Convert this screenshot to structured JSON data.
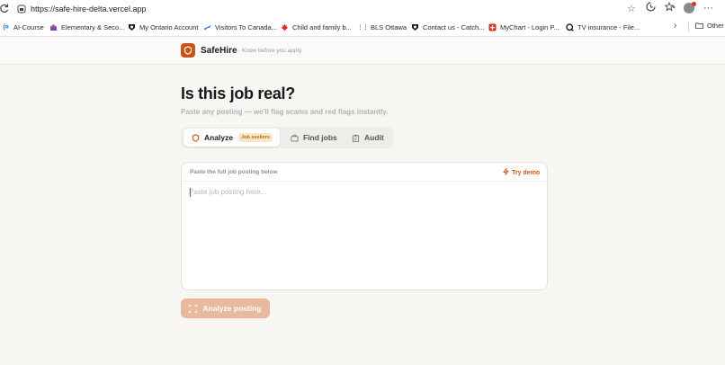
{
  "browser": {
    "url": "https://safe-hire-delta.vercel.app",
    "bookmarks": [
      {
        "label": "AI-Course",
        "icon": "course-icon",
        "color": "#1a73e8"
      },
      {
        "label": "Elementary & Seco...",
        "icon": "school-icon",
        "color": "#7b4bb3"
      },
      {
        "label": "My Ontario Account",
        "icon": "ontario-icon",
        "color": "#1b1b1b"
      },
      {
        "label": "Visitors To Canada...",
        "icon": "plane-icon",
        "color": "#3b7fd1"
      },
      {
        "label": "Child and family b...",
        "icon": "maple-leaf-icon",
        "color": "#d52b1e"
      },
      {
        "label": "BLS Ottawa",
        "icon": "bls-icon",
        "color": "#555555"
      },
      {
        "label": "Contact us - Catch...",
        "icon": "catch-icon",
        "color": "#1b1b1b"
      },
      {
        "label": "MyChart - Login P...",
        "icon": "mychart-icon",
        "color": "#d93025"
      },
      {
        "label": "TV insurance - File...",
        "icon": "search-q-icon",
        "color": "#1b1b1b"
      }
    ],
    "other_bookmarks": "Other b"
  },
  "app": {
    "brand": "SafeHire",
    "tagline": "· Know before you apply.",
    "accent": "#c9541a"
  },
  "main": {
    "title": "Is this job real?",
    "subtitle": "Paste any posting — we'll flag scams and red flags instantly.",
    "tabs": [
      {
        "label": "Analyze",
        "badge": "Job seekers",
        "active": true,
        "icon": "shield-icon"
      },
      {
        "label": "Find jobs",
        "active": false,
        "icon": "briefcase-icon"
      },
      {
        "label": "Audit",
        "active": false,
        "icon": "clipboard-icon"
      }
    ],
    "card": {
      "label": "Paste the full job posting below",
      "try_demo": "Try demo",
      "placeholder": "Paste job posting here..."
    },
    "analyze_button": "Analyze posting"
  }
}
